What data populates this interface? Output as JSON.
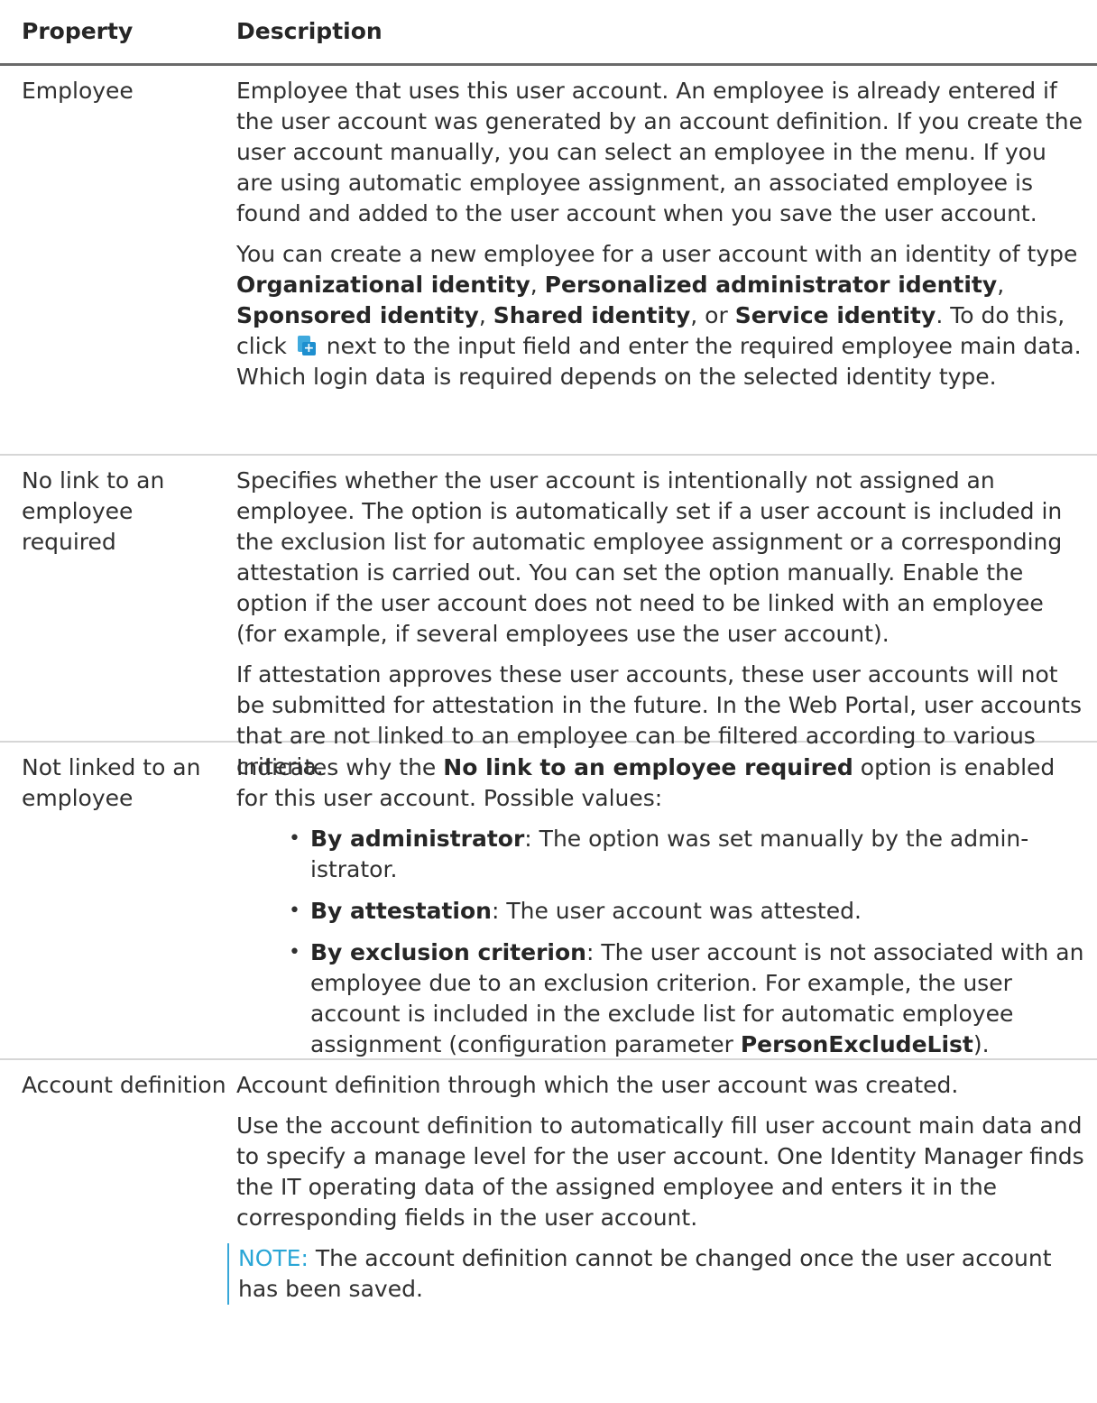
{
  "table": {
    "header": {
      "property": "Property",
      "description": "Description"
    },
    "employee": {
      "property": "Employee",
      "p1": "Employee that uses this user account. An employee is already entered if the user account was generated by an account definition. If you create the user account manually, you can select an employee in the menu. If you are using automatic employee assignment, an associated employee is found and added to the user account when you save the user account.",
      "p2": {
        "t1": "You can create a new employee for a user account with an identity of type ",
        "b1": "Organizational identity",
        "t2": ", ",
        "b2": "Personalized administrator identity",
        "t3": ", ",
        "b3": "Sponsored identity",
        "t4": ", ",
        "b4": "Shared identity",
        "t5": ", or ",
        "b5": "Service identity",
        "t6": ". To do this, click ",
        "icon": "add-employee-icon",
        "t7": " next to the input field and enter the required employee main data. Which login data is required depends on the selected identity type."
      }
    },
    "no_link": {
      "property": "No link to an employee required",
      "p1": "Specifies whether the user account is intentionally not assigned an employee. The option is automatically set if a user account is included in the exclusion list for automatic employee assignment or a corresponding attestation is carried out. You can set the option manually. Enable the option if the user account does not need to be linked with an employee (for example, if several employees use the user account).",
      "p2": "If attestation approves these user accounts, these user accounts will not be submitted for attestation in the future. In the Web Portal, user accounts that are not linked to an employee can be filtered according to various criteria."
    },
    "not_linked": {
      "property": "Not linked to an employee",
      "intro_t1": "Indicates why the ",
      "intro_b": "No link to an employee required",
      "intro_t2": " option is enabled for this user account. Possible values:",
      "items": [
        {
          "label": "By administrator",
          "text": ": The option was set manually by the admin-istrator."
        },
        {
          "label": "By attestation",
          "text": ": The user account was attested."
        },
        {
          "label": "By exclusion criterion",
          "text": ": The user account is not associated with an employee due to an exclusion criterion. For example, the user account is included in the exclude list for automatic employee assignment (configuration parameter ",
          "param": "PersonExcludeList",
          "tail": ")."
        }
      ]
    },
    "account_def": {
      "property": "Account definition",
      "p1": "Account definition through which the user account was created.",
      "p2": "Use the account definition to automatically fill user account main data and to specify a manage level for the user account. One Identity Manager finds the IT operating data of the assigned employee and enters it in the corresponding fields in the user account.",
      "note_label": "NOTE:",
      "note_text": " The account definition cannot be changed once the user account has been saved."
    }
  },
  "colors": {
    "note_accent": "#2aa6d6",
    "icon_blue": "#3fa9dd"
  }
}
